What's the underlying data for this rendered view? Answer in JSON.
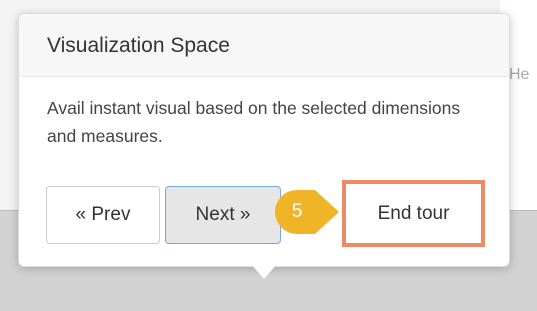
{
  "background": {
    "partial_text": "He"
  },
  "popover": {
    "title": "Visualization Space",
    "content": "Avail instant visual based on the selected dimensions and measures."
  },
  "buttons": {
    "prev_label": "« Prev",
    "next_label": "Next »",
    "end_label": "End tour"
  },
  "step": {
    "number": "5",
    "marker_color": "#f0b429"
  },
  "colors": {
    "highlight_border": "#ee8a66",
    "next_border": "#7aa7dd"
  }
}
